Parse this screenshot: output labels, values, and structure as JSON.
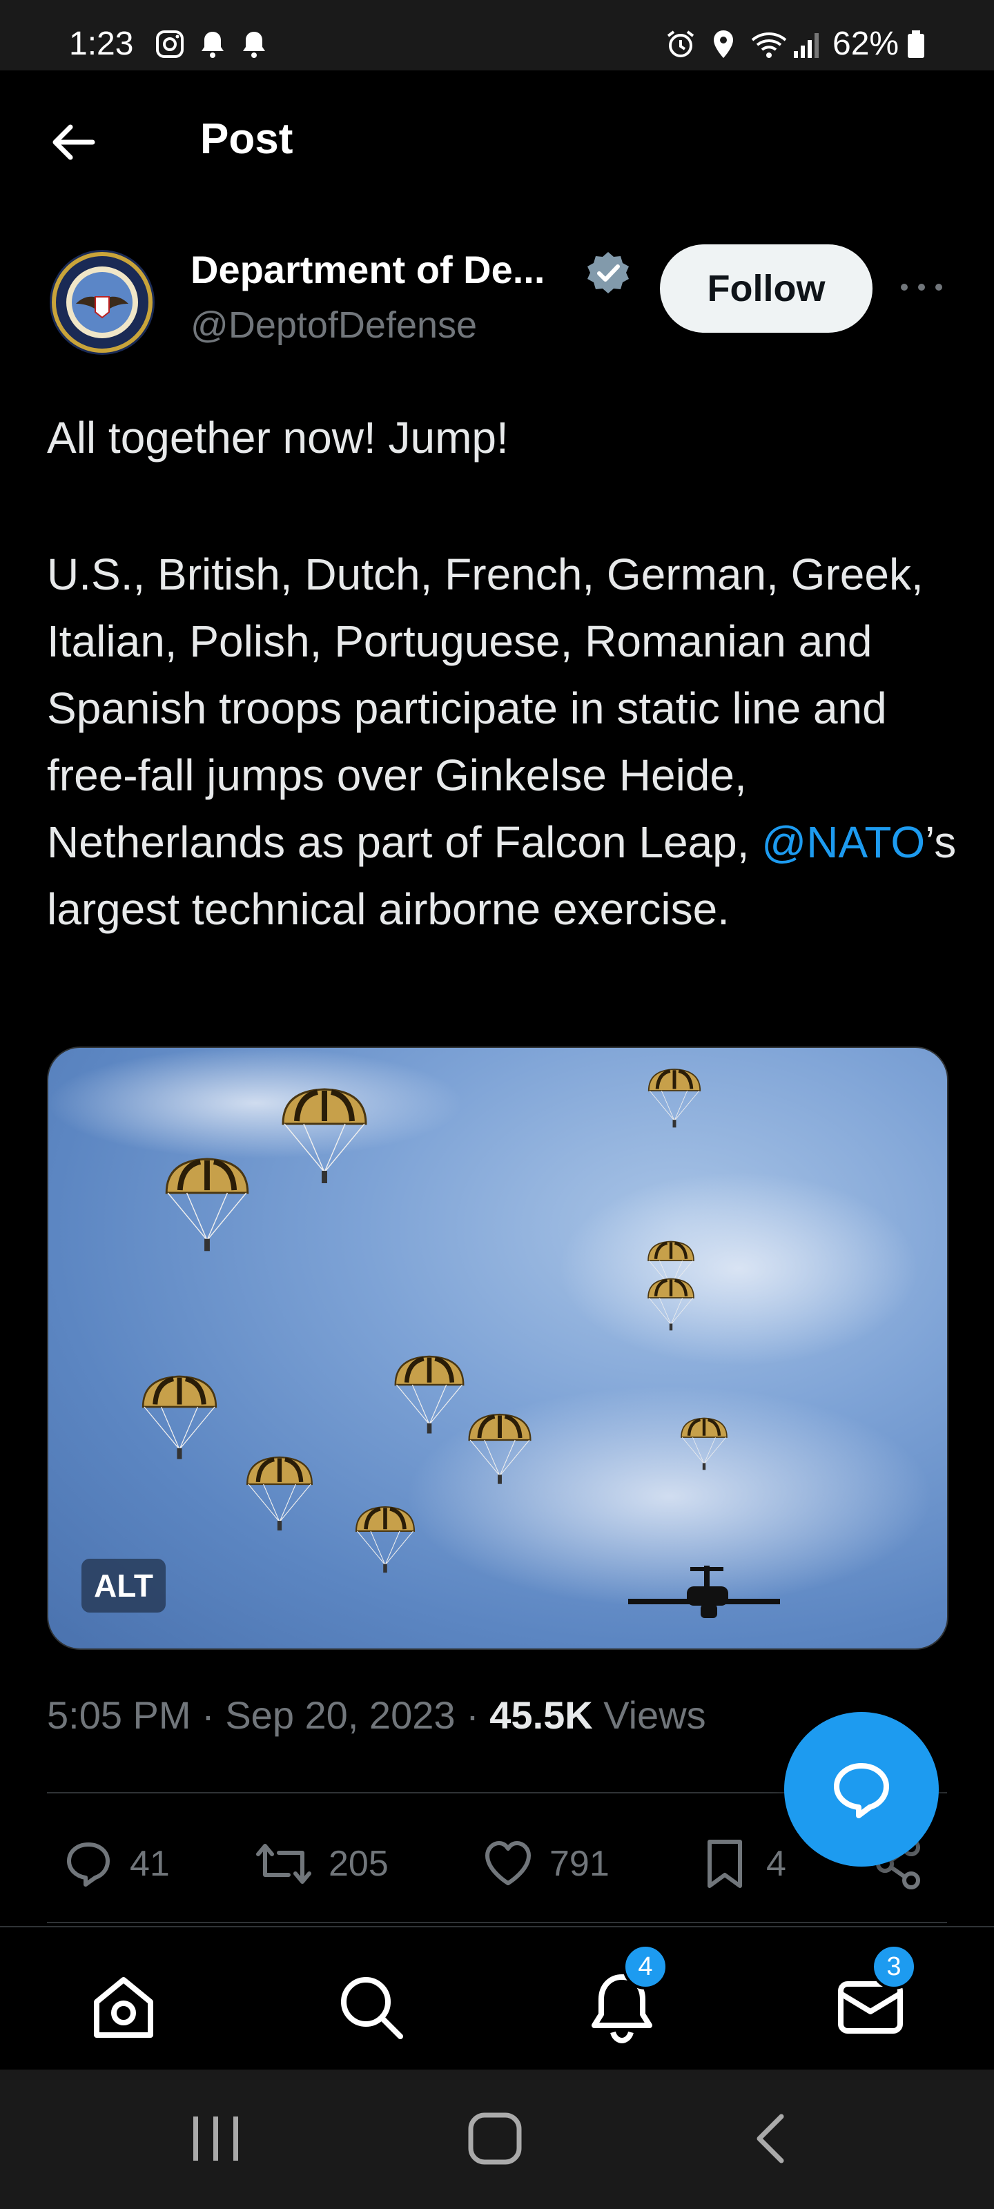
{
  "status_bar": {
    "time": "1:23",
    "battery": "62%",
    "icons": [
      "instagram-icon",
      "bell-icon",
      "bell-icon",
      "alarm-icon",
      "location-icon",
      "wifi-icon",
      "signal-icon",
      "battery-icon"
    ]
  },
  "header": {
    "title": "Post",
    "back_icon": "arrow-left-icon"
  },
  "author": {
    "name": "Department of De...",
    "handle": "@DeptofDefense",
    "verified_icon": "verified-badge-icon",
    "follow_label": "Follow",
    "more_icon": "more-icon"
  },
  "post": {
    "line1": "All together now! Jump!",
    "body_before_mention": "U.S., British, Dutch, French, German, Greek, Italian, Polish, Portuguese, Romanian and Spanish troops participate in static line and free-fall jumps over Ginkelse Heide, Netherlands as part of Falcon Leap, ",
    "mention": "@NATO",
    "body_after_mention": "’s largest technical airborne exercise.",
    "media_alt_label": "ALT"
  },
  "meta": {
    "time": "5:05 PM",
    "sep1": " · ",
    "date": "Sep 20, 2023",
    "sep2": " · ",
    "views_count": "45.5K",
    "views_label": " Views"
  },
  "actions": {
    "replies": "41",
    "reposts": "205",
    "likes": "791",
    "bookmarks": "4"
  },
  "bottom_nav": {
    "notifications_badge": "4",
    "messages_badge": "3"
  },
  "colors": {
    "accent": "#1d9bf0",
    "background": "#000000",
    "muted": "#71767b",
    "text": "#e7e9ea"
  }
}
